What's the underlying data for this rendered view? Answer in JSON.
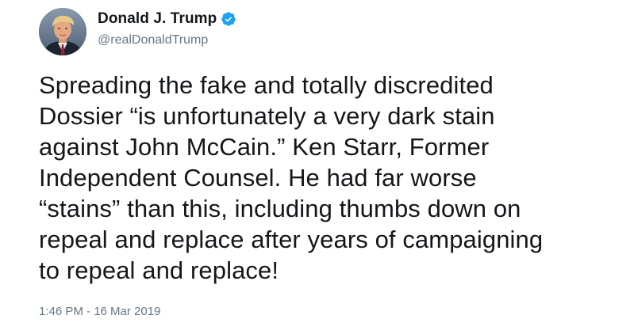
{
  "user": {
    "display_name": "Donald J. Trump",
    "handle": "@realDonaldTrump",
    "verified": true,
    "avatar_icon": "profile-photo",
    "verified_icon": "verified-badge-icon"
  },
  "tweet": {
    "text": "Spreading the fake and totally discredited\nDossier “is unfortunately a very dark stain\nagainst John McCain.” Ken Starr, Former\nIndependent Counsel. He had far worse\n“stains” than this, including thumbs down on\nrepeal and replace after years of campaigning\nto repeal and replace!",
    "timestamp": "1:46 PM - 16 Mar 2019"
  },
  "colors": {
    "text": "#14171a",
    "secondary": "#657786",
    "verified": "#1da1f2"
  }
}
